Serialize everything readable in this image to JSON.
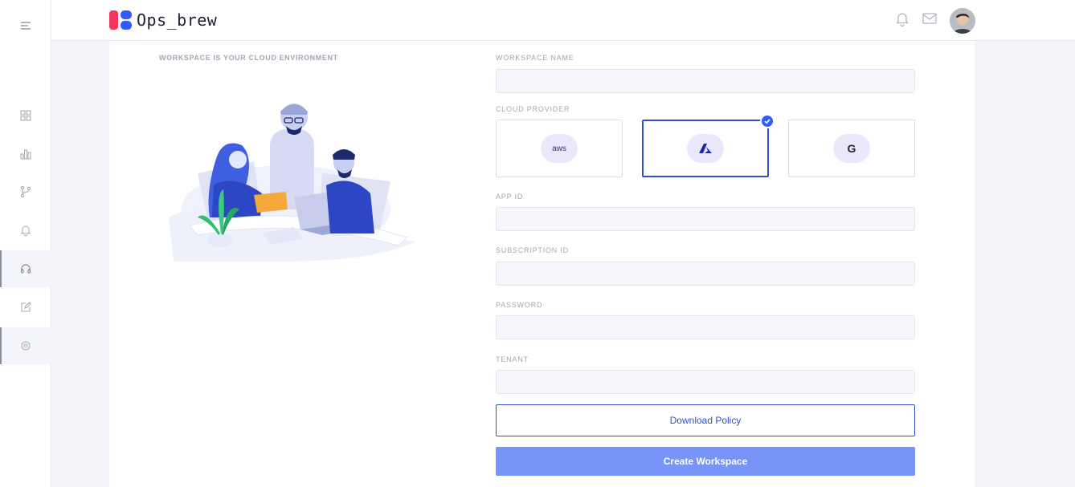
{
  "app": {
    "name": "Ops_brew"
  },
  "sidebar": {
    "items": [
      {
        "icon": "menu-icon"
      },
      {
        "icon": "grid-icon"
      },
      {
        "icon": "bar-chart-icon"
      },
      {
        "icon": "git-branch-icon"
      },
      {
        "icon": "bell-icon"
      },
      {
        "icon": "headphones-icon",
        "active": true
      },
      {
        "icon": "edit-icon"
      },
      {
        "icon": "settings-icon",
        "active": true
      }
    ]
  },
  "topbar": {
    "icons": [
      "bell-icon",
      "mail-icon",
      "avatar"
    ]
  },
  "intro": {
    "title": "WORKSPACE IS YOUR CLOUD ENVIRONMENT"
  },
  "form": {
    "workspace_name": {
      "label": "WORKSPACE NAME",
      "value": ""
    },
    "cloud_provider": {
      "label": "CLOUD PROVIDER",
      "options": [
        {
          "id": "aws",
          "text": "aws",
          "icon": "aws-icon"
        },
        {
          "id": "azure",
          "text": "",
          "icon": "azure-icon"
        },
        {
          "id": "gcp",
          "text": "G",
          "icon": "google-icon"
        }
      ],
      "selected": "azure"
    },
    "app_id": {
      "label": "APP ID",
      "value": ""
    },
    "subscription_id": {
      "label": "SUBSCRIPTION ID",
      "value": ""
    },
    "password": {
      "label": "PASSWORD",
      "value": ""
    },
    "tenant": {
      "label": "TENANT",
      "value": ""
    },
    "download_policy_label": "Download Policy",
    "create_label": "Create Workspace"
  },
  "colors": {
    "primary": "#2f5bff",
    "primary_light": "#7795f8",
    "border_selected": "#3152c7",
    "logo_red": "#f5365c"
  }
}
